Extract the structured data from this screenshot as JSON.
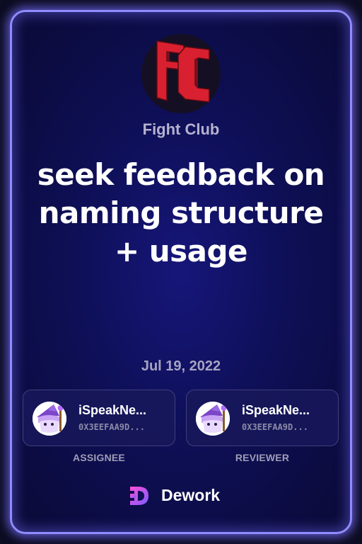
{
  "organization": {
    "name": "Fight Club",
    "logo_icon": "fight-club-logo",
    "logo_color": "#d92030"
  },
  "task": {
    "title": "seek feedback on naming structure + usage",
    "date": "Jul 19, 2022"
  },
  "assignee": {
    "name": "iSpeakNe...",
    "address": "0X3EEFAA9D...",
    "role_label": "ASSIGNEE",
    "avatar_icon": "wizard-avatar"
  },
  "reviewer": {
    "name": "iSpeakNe...",
    "address": "0X3EEFAA9D...",
    "role_label": "REVIEWER",
    "avatar_icon": "wizard-avatar"
  },
  "brand": {
    "name": "Dework",
    "icon": "dework-logo",
    "gradient": [
      "#ff4fd8",
      "#7b5cff"
    ]
  },
  "colors": {
    "card_border": "#8f8cff",
    "card_background": "#0e0f56"
  }
}
